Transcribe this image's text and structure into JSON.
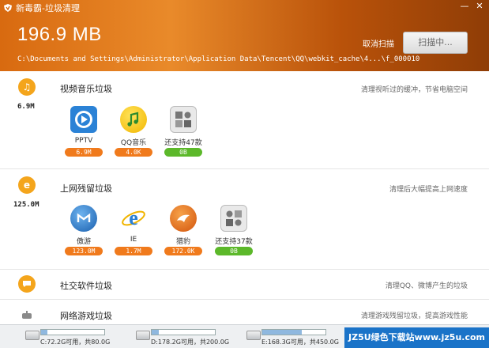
{
  "window": {
    "title": "新毒霸-垃圾清理",
    "minimize": "—",
    "close": "✕"
  },
  "scan": {
    "total_size": "196.9 MB",
    "current_path": "C:\\Documents and Settings\\Administrator\\Application Data\\Tencent\\QQ\\webkit_cache\\4...\\f_000010",
    "cancel_label": "取消扫描",
    "scan_button_label": "扫描中..."
  },
  "sections": [
    {
      "title": "视频音乐垃圾",
      "size": "6.9M",
      "description": "清理视听过的缓冲，节省电脑空间",
      "icon": "music-note-icon",
      "color": "#f4a51c",
      "items": [
        {
          "name": "PPTV",
          "size": "6.9M",
          "icon": "pptv-icon",
          "status": "orange"
        },
        {
          "name": "QQ音乐",
          "size": "4.0K",
          "icon": "qq-music-icon",
          "status": "orange"
        },
        {
          "name": "还支持47款",
          "size": "0B",
          "icon": "more-apps-icon",
          "status": "green"
        }
      ]
    },
    {
      "title": "上网残留垃圾",
      "size": "125.0M",
      "description": "清理后大幅提高上网速度",
      "icon": "browser-e-icon",
      "color": "#f4a51c",
      "items": [
        {
          "name": "傲游",
          "size": "123.0M",
          "icon": "maxthon-icon",
          "status": "orange"
        },
        {
          "name": "IE",
          "size": "1.7M",
          "icon": "ie-icon",
          "status": "orange"
        },
        {
          "name": "猎豹",
          "size": "172.0K",
          "icon": "liebao-icon",
          "status": "orange"
        },
        {
          "name": "还支持37款",
          "size": "0B",
          "icon": "more-apps-icon",
          "status": "green"
        }
      ]
    },
    {
      "title": "社交软件垃圾",
      "description": "清理QQ、微博产生的垃圾",
      "icon": "chat-bubble-icon",
      "color": "#f4a51c"
    },
    {
      "title": "网络游戏垃圾",
      "description": "清理游戏残留垃圾，提高游戏性能",
      "icon": "gamepad-icon",
      "color": "#8a8a8a"
    }
  ],
  "drives": [
    {
      "label": "C:72.2G可用，共80.0G",
      "used_fraction": 0.1
    },
    {
      "label": "D:178.2G可用，共200.0G",
      "used_fraction": 0.11
    },
    {
      "label": "E:168.3G可用，共450.0G",
      "used_fraction": 0.63
    }
  ],
  "watermark": "JZ5U绿色下载站www.jz5u.com"
}
